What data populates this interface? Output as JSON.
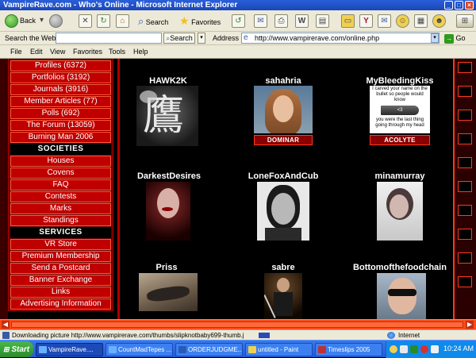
{
  "window": {
    "title": "VampireRave.com - Who's Online - Microsoft Internet Explorer"
  },
  "toolbar": {
    "back_label": "Back",
    "search_label": "Search",
    "favorites_label": "Favorites"
  },
  "address_bar": {
    "search_web_label": "Search the Web",
    "search_button_label": "Search",
    "address_label": "Address",
    "url": "http://www.vampirerave.com/online.php",
    "go_label": "Go"
  },
  "menu": {
    "items": [
      "File",
      "Edit",
      "View",
      "Favorites",
      "Tools",
      "Help"
    ]
  },
  "sidebar": {
    "items": [
      {
        "label": "Profiles (6372)"
      },
      {
        "label": "Portfolios (3192)"
      },
      {
        "label": "Journals (3916)"
      },
      {
        "label": "Member Articles (77)"
      },
      {
        "label": "Polls (692)"
      },
      {
        "label": "The Forum (13059)"
      },
      {
        "label": "Burning Man 2006"
      }
    ],
    "societies_header": "SOCIETIES",
    "societies": [
      {
        "label": "Houses"
      },
      {
        "label": "Covens"
      },
      {
        "label": "FAQ"
      },
      {
        "label": "Contests"
      },
      {
        "label": "Marks"
      },
      {
        "label": "Standings"
      }
    ],
    "services_header": "SERVICES",
    "services": [
      {
        "label": "VR Store"
      },
      {
        "label": "Premium Membership"
      },
      {
        "label": "Send a Postcard"
      },
      {
        "label": "Banner Exchange"
      },
      {
        "label": "Links"
      },
      {
        "label": "Advertising Information"
      }
    ]
  },
  "members": [
    {
      "name": "HAWK2K",
      "glyph": "鷹"
    },
    {
      "name": "sahahria",
      "badge": "DOMINAR"
    },
    {
      "name": "MyBleedingKiss",
      "caption_top": "I carved your name on the bullet so people would know",
      "bullet_text": "<3",
      "caption_bottom": "you were the last thing going through my head",
      "badge": "ACOLYTE"
    },
    {
      "name": "DarkestDesires"
    },
    {
      "name": "LoneFoxAndCub"
    },
    {
      "name": "minamurray"
    },
    {
      "name": "Priss"
    },
    {
      "name": "sabre"
    },
    {
      "name": "Bottomofthefoodchain"
    }
  ],
  "status_bar": {
    "text": "Downloading picture http://www.vampirerave.com/thumbs/slipknotbaby699-thumb.j",
    "zone": "Internet"
  },
  "taskbar": {
    "start_label": "Start",
    "tasks": [
      {
        "label": "VampireRave...."
      },
      {
        "label": "CountMadTepes ..."
      },
      {
        "label": "ORDERJUDGME..."
      },
      {
        "label": "untitled - Paint"
      },
      {
        "label": "Timeslips 2005"
      }
    ],
    "clock": "10:24 AM"
  }
}
